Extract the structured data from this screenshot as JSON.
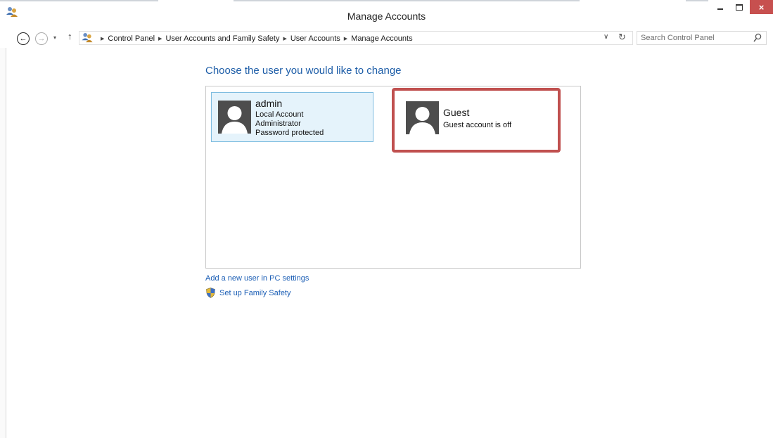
{
  "window": {
    "title": "Manage Accounts",
    "icon": "user-accounts-icon",
    "controls": {
      "minimize": "minimize-icon",
      "maximize": "maximize-icon",
      "close": "×"
    }
  },
  "navigation": {
    "back_icon": "←",
    "forward_icon": "→",
    "recent_icon": "▾",
    "up_icon": "↑",
    "breadcrumb": [
      "Control Panel",
      "User Accounts and Family Safety",
      "User Accounts",
      "Manage Accounts"
    ],
    "breadcrumb_separator": "▶",
    "dropdown_icon": "∨",
    "refresh_icon": "↻",
    "search_placeholder": "Search Control Panel"
  },
  "main": {
    "heading": "Choose the user you would like to change",
    "accounts": [
      {
        "name": "admin",
        "details": [
          "Local Account",
          "Administrator",
          "Password protected"
        ],
        "selected": true
      },
      {
        "name": "Guest",
        "details": [
          "Guest account is off"
        ],
        "selected": false,
        "highlighted": true
      }
    ],
    "links": [
      {
        "label": "Add a new user in PC settings"
      },
      {
        "label": "Set up Family Safety",
        "icon": "uac-shield-icon"
      }
    ]
  },
  "colors": {
    "heading": "#1e5ea8",
    "link": "#1b5eb5",
    "selected_tile_bg": "#e5f3fb",
    "selected_tile_border": "#7fbde0",
    "highlight_border": "#c0504f",
    "close_button": "#c7504f",
    "avatar_bg": "#4d4d4d"
  }
}
